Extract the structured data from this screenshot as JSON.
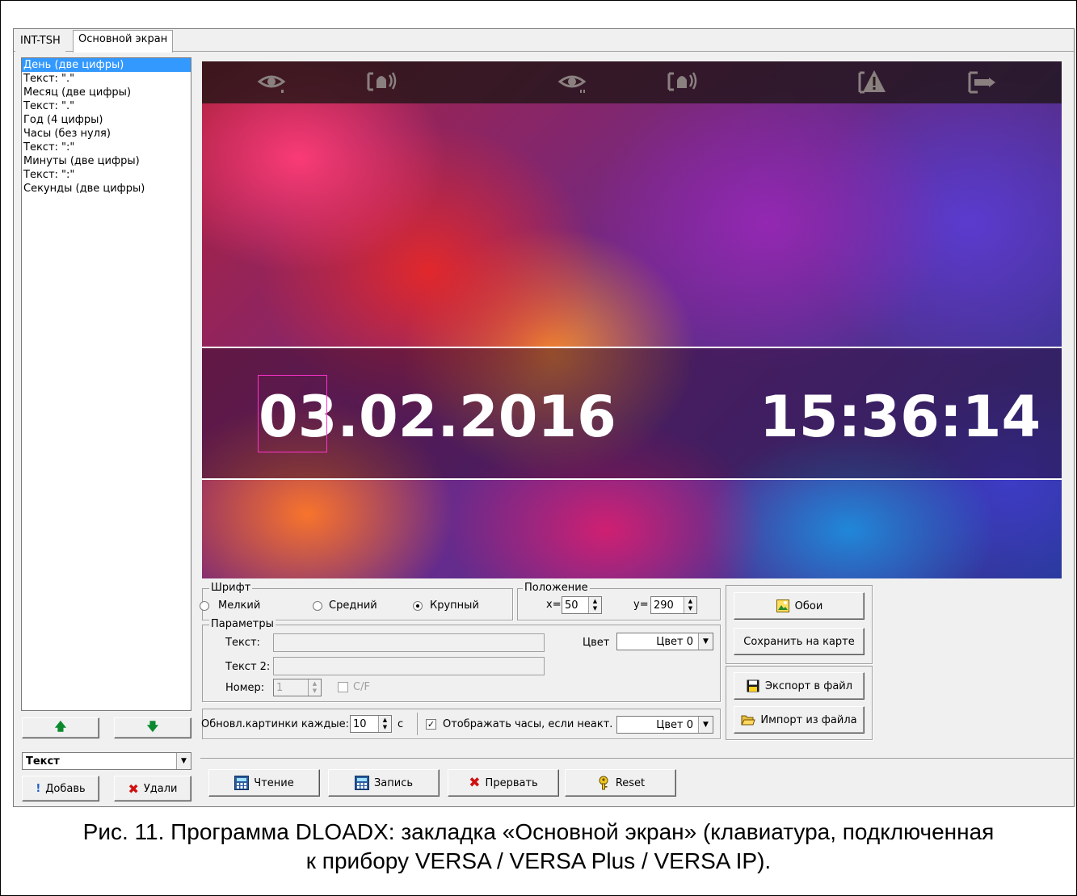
{
  "tabs": [
    {
      "label": "INT-TSH"
    },
    {
      "label": "Основной экран"
    }
  ],
  "element_list": [
    "День (две цифры)",
    "Текст: \".\"",
    "Месяц (две цифры)",
    "Текст: \".\"",
    "Год (4 цифры)",
    "Часы (без нуля)",
    "Текст: \":\"",
    "Минуты (две цифры)",
    "Текст: \":\"",
    "Секунды (две цифры)"
  ],
  "element_type_combo": {
    "value": "Текст"
  },
  "buttons": {
    "add": "Добавь",
    "delete": "Удали",
    "wallpaper": "Обои",
    "save_card": "Сохранить на карте",
    "export": "Экспорт в файл",
    "import": "Импорт из файла",
    "read": "Чтение",
    "write": "Запись",
    "abort": "Прервать",
    "reset": "Reset"
  },
  "preview": {
    "date": "03.02.2016",
    "time": "15:36:14",
    "icons": [
      "eye-icon",
      "alarm-icon",
      "eye-icon",
      "alarm-icon",
      "warning-icon",
      "exit-icon"
    ]
  },
  "font_group": {
    "title": "Шрифт",
    "options": [
      "Мелкий",
      "Средний",
      "Крупный"
    ],
    "selected": "Крупный"
  },
  "position_group": {
    "title": "Положение",
    "x_label": "x=",
    "x_value": "50",
    "y_label": "y=",
    "y_value": "290"
  },
  "params_group": {
    "title": "Параметры",
    "text_label": "Текст:",
    "text_value": "",
    "text2_label": "Текст 2:",
    "text2_value": "",
    "number_label": "Номер:",
    "number_value": "1",
    "cf_label": "C/F",
    "color_label": "Цвет",
    "color_value": "Цвет 0"
  },
  "refresh": {
    "label": "Обновл.картинки каждые:",
    "value": "10",
    "unit": "с",
    "show_clock_label": "Отображать часы, если неакт.",
    "show_clock_checked": true,
    "color_value": "Цвет 0"
  },
  "caption": {
    "line1": "Рис. 11. Программа DLOADX: закладка «Основной экран» (клавиатура, подключенная",
    "line2": "к прибору VERSA / VERSA Plus / VERSA IP)."
  },
  "colors": {
    "selection": "#3399ff",
    "cursor_frame": "#ff33cc",
    "arrow_green": "#0a8a2e",
    "delete_red": "#d01010"
  }
}
